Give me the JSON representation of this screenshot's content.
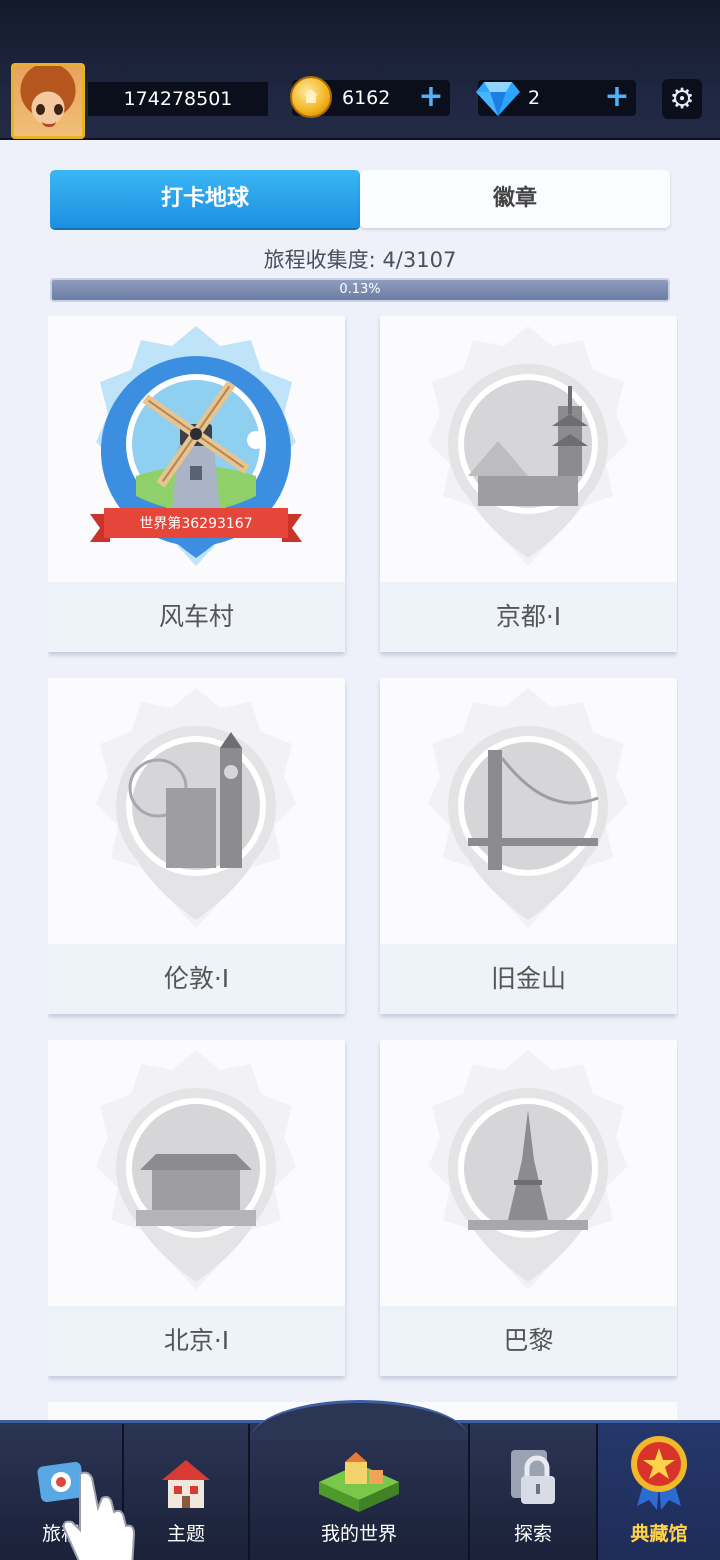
{
  "header": {
    "user_id": "174278501",
    "coins": "6162",
    "gems": "2",
    "coin_plus": "+",
    "gem_plus": "+",
    "settings_icon": "gear-icon"
  },
  "tabs": [
    {
      "label": "打卡地球",
      "active": true
    },
    {
      "label": "徽章",
      "active": false
    }
  ],
  "progress": {
    "label": "旅程收集度: 4/3107",
    "percent_text": "0.13%",
    "fraction": 0.0013
  },
  "cards": [
    {
      "name": "风车村",
      "unlocked": true,
      "ribbon": "世界第36293167",
      "icon": "windmill-badge-icon"
    },
    {
      "name": "京都·I",
      "unlocked": false,
      "icon": "kyoto-badge-icon"
    },
    {
      "name": "伦敦·I",
      "unlocked": false,
      "icon": "london-badge-icon"
    },
    {
      "name": "旧金山",
      "unlocked": false,
      "icon": "san-francisco-badge-icon"
    },
    {
      "name": "北京·I",
      "unlocked": false,
      "icon": "beijing-badge-icon"
    },
    {
      "name": "巴黎",
      "unlocked": false,
      "icon": "paris-badge-icon"
    }
  ],
  "nav": [
    {
      "label": "旅程",
      "icon": "journey-icon"
    },
    {
      "label": "主题",
      "icon": "theme-house-icon"
    },
    {
      "label": "我的世界",
      "icon": "my-world-icon"
    },
    {
      "label": "探索",
      "icon": "lock-icon"
    },
    {
      "label": "典藏馆",
      "icon": "medal-icon",
      "active": true
    }
  ],
  "colors": {
    "tab_active": "#1d8fe0",
    "nav_active_label": "#ffd24a",
    "ribbon": "#e6453a"
  }
}
